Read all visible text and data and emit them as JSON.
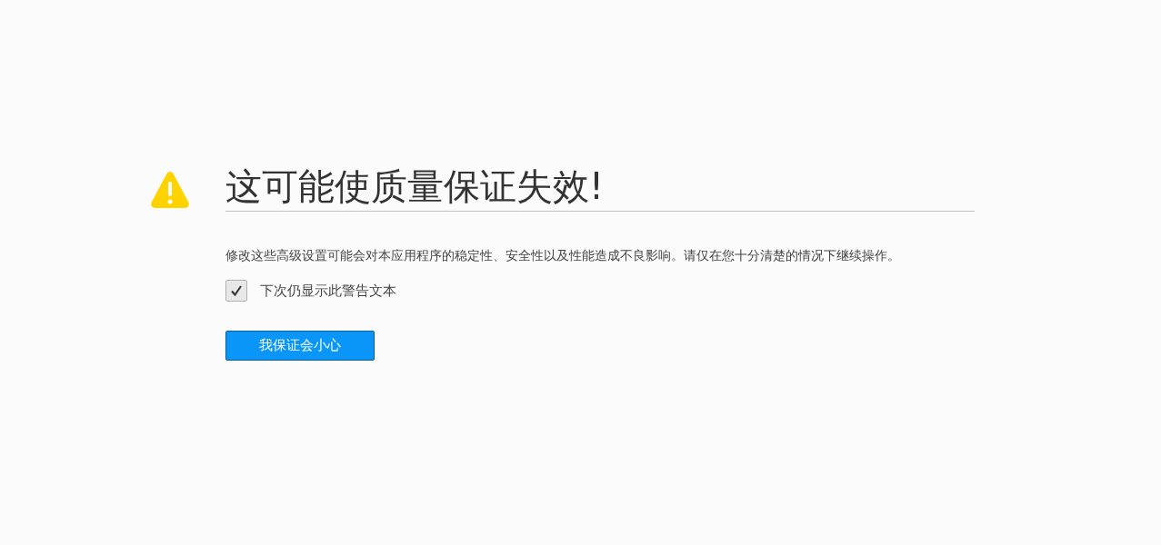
{
  "title": "这可能使质量保证失效!",
  "description": "修改这些高级设置可能会对本应用程序的稳定性、安全性以及性能造成不良影响。请仅在您十分清楚的情况下继续操作。",
  "checkbox": {
    "label": "下次仍显示此警告文本",
    "checked": true
  },
  "button": {
    "label": "我保证会小心"
  }
}
